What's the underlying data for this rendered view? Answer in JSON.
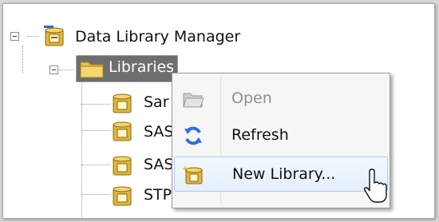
{
  "tree": {
    "root": {
      "label": "Data Library Manager",
      "icon": "library-database-icon",
      "expanded": true
    },
    "libraries_node": {
      "label": "Libraries",
      "icon": "folder-icon",
      "expanded": true,
      "selected": true
    },
    "children": [
      {
        "label": "Sar",
        "icon": "library-icon"
      },
      {
        "label": "SAS",
        "icon": "library-icon"
      },
      {
        "label": "SAS",
        "icon": "library-icon"
      },
      {
        "label": "STP Samples",
        "icon": "library-icon"
      }
    ]
  },
  "context_menu": {
    "items": [
      {
        "label": "Open",
        "icon": "open-folder-icon",
        "enabled": false
      },
      {
        "label": "Refresh",
        "icon": "refresh-icon",
        "enabled": true
      },
      {
        "label": "New Library...",
        "icon": "new-library-icon",
        "enabled": true,
        "highlighted": true
      }
    ]
  },
  "colors": {
    "selection": "#6e6e6e",
    "menu_highlight": "#e4effc",
    "disabled_text": "#8f8f8f"
  }
}
